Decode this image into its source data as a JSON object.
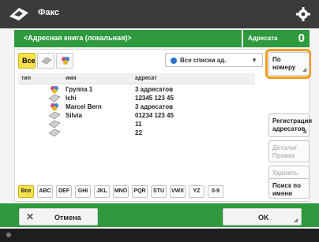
{
  "titlebar": {
    "title": "Факс",
    "icon": "fax-icon",
    "settings_icon": "gear-icon"
  },
  "header": {
    "path": "<Адресная книга (локальная)>",
    "count_label": "Адресата",
    "count_value": "0"
  },
  "tabs": {
    "all_label": "Все",
    "dropdown_value": "Все списки ад.",
    "dropdown_icon": "globe-icon"
  },
  "table": {
    "columns": {
      "type": "тип",
      "name": "имя",
      "address": "адресат"
    },
    "rows": [
      {
        "icon": "group-icon",
        "name": "Группа 1",
        "address": "3 адресатов"
      },
      {
        "icon": "fax-machine-icon",
        "name": "Ichi",
        "address": "12345 123 45"
      },
      {
        "icon": "group-icon",
        "name": "Marcel Bern",
        "address": "3 адресатов"
      },
      {
        "icon": "fax-machine-icon",
        "name": "Silvia",
        "address": "01234 123 45"
      },
      {
        "icon": "fax-machine-icon",
        "name": "",
        "address": "11"
      },
      {
        "icon": "fax-machine-icon",
        "name": "",
        "address": "22"
      }
    ]
  },
  "side": {
    "by_number": "По номеру",
    "register": "Регистрация адресатов",
    "details": "Детали/ Правка",
    "delete": "Удалить",
    "search": "Поиск по имени"
  },
  "alpha_tabs": [
    "Все",
    "ABC",
    "DEF",
    "GHI",
    "JKL",
    "MNO",
    "PQR",
    "STU",
    "VWX",
    "YZ",
    "0-9"
  ],
  "footer": {
    "cancel": "Отмена",
    "ok": "OK"
  },
  "colors": {
    "accent": "#2e9a3d",
    "selected": "#f6e14a",
    "highlight": "#f39a12"
  }
}
